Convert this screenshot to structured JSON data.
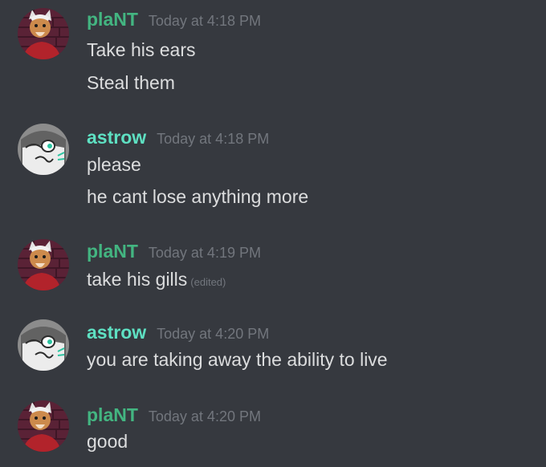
{
  "colors": {
    "background": "#36393f",
    "text": "#dcddde",
    "muted": "#72767d",
    "plant": "#43b581",
    "astrow": "#5ee0c2"
  },
  "messages": [
    {
      "author": "plaNT",
      "timestamp": "Today at 4:18 PM",
      "avatar_icon": "fox-avatar-icon",
      "lines": [
        "Take his ears",
        "Steal them"
      ]
    },
    {
      "author": "astrow",
      "timestamp": "Today at 4:18 PM",
      "avatar_icon": "shark-avatar-icon",
      "lines": [
        "please",
        "he cant lose anything more"
      ]
    },
    {
      "author": "plaNT",
      "timestamp": "Today at 4:19 PM",
      "avatar_icon": "fox-avatar-icon",
      "lines": [
        "take his gills"
      ],
      "edited_label": "(edited)"
    },
    {
      "author": "astrow",
      "timestamp": "Today at 4:20 PM",
      "avatar_icon": "shark-avatar-icon",
      "lines": [
        "you are taking away the ability to live"
      ]
    },
    {
      "author": "plaNT",
      "timestamp": "Today at 4:20 PM",
      "avatar_icon": "fox-avatar-icon",
      "lines": [
        "good"
      ]
    }
  ]
}
